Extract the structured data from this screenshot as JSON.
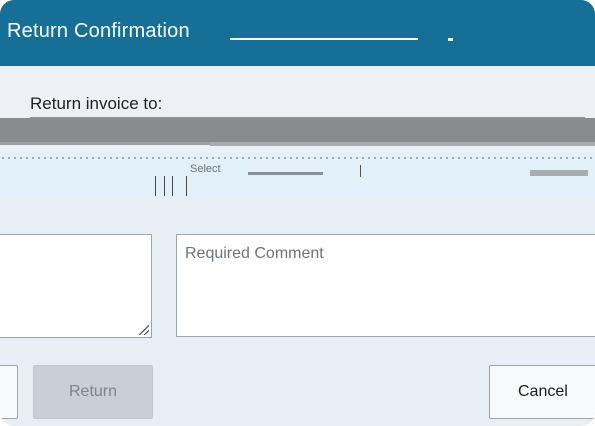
{
  "dialog": {
    "title": "Return Confirmation"
  },
  "return_section": {
    "label": "Return invoice to:",
    "select_placeholder": "Select"
  },
  "comment": {
    "placeholder": "Required Comment"
  },
  "buttons": {
    "return_label": "Return",
    "cancel_label": "Cancel"
  },
  "colors": {
    "titlebar": "#156f96",
    "dialog_bg": "#e8eef4",
    "select_row_bg": "#e2f1f9"
  },
  "icons": {
    "resize_grip": "resize-grip-icon"
  }
}
